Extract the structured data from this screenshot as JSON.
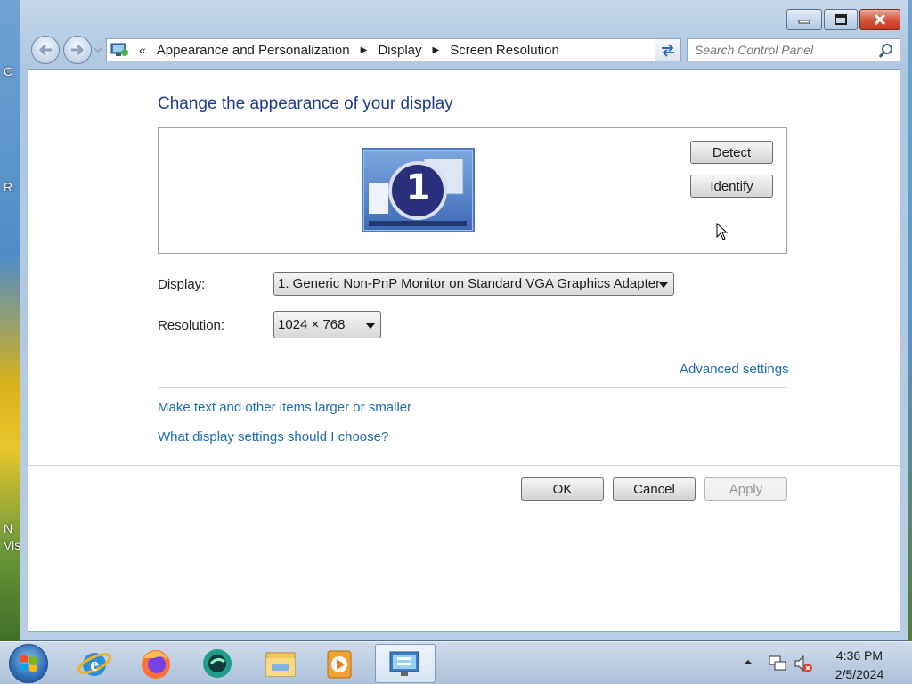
{
  "desktop": {
    "left_texts": [
      "C",
      "R",
      "N",
      "Vis"
    ]
  },
  "window": {
    "buttons": {
      "minimize": "minimize",
      "maximize": "maximize",
      "close": "close"
    }
  },
  "address": {
    "prefix": "«",
    "crumbs": [
      "Appearance and Personalization",
      "Display",
      "Screen Resolution"
    ]
  },
  "search": {
    "placeholder": "Search Control Panel"
  },
  "main": {
    "heading": "Change the appearance of your display",
    "monitor_number": "1",
    "detect_label": "Detect",
    "identify_label": "Identify",
    "display_label": "Display:",
    "display_value": "1. Generic Non-PnP Monitor on Standard VGA Graphics Adapter",
    "resolution_label": "Resolution:",
    "resolution_value": "1024 × 768",
    "advanced_link": "Advanced settings",
    "text_size_link": "Make text and other items larger or smaller",
    "help_link": "What display settings should I choose?",
    "ok_label": "OK",
    "cancel_label": "Cancel",
    "apply_label": "Apply"
  },
  "taskbar": {
    "icons": [
      "start-orb",
      "internet-explorer-icon",
      "firefox-icon",
      "chat-app-icon",
      "file-explorer-icon",
      "media-player-icon",
      "control-panel-display-icon"
    ],
    "time": "4:36 PM",
    "date": "2/5/2024"
  },
  "colors": {
    "heading": "#1e3c87",
    "link": "#1a6cb3",
    "window_frame": "#b7cde4",
    "close_button": "#c6361b"
  }
}
